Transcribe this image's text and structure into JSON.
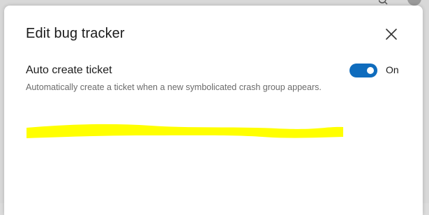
{
  "dialog": {
    "title": "Edit bug tracker",
    "close_icon": "close-icon"
  },
  "setting": {
    "label": "Auto create ticket",
    "description": "Automatically create a ticket when a new symbolicated crash group appears.",
    "toggle": {
      "checked": true,
      "state_label": "On",
      "accent_color": "#0f6cbd"
    }
  },
  "redaction": {
    "color": "#ffff00"
  }
}
